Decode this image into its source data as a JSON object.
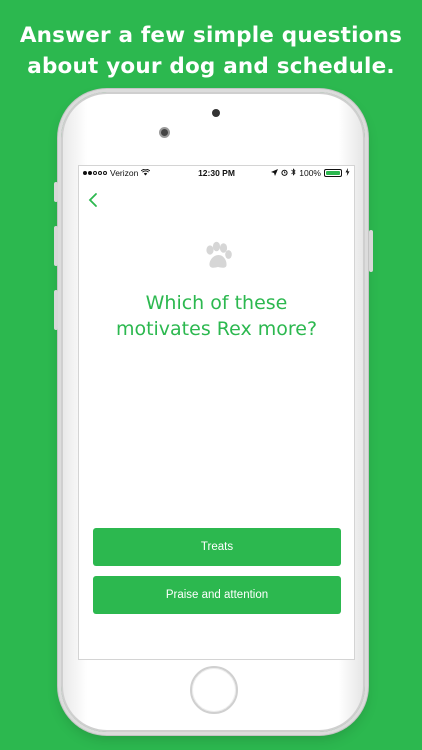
{
  "headline": {
    "line1": "Answer a few simple questions",
    "line2": "about your dog and schedule."
  },
  "status_bar": {
    "carrier": "Verizon",
    "time": "12:30 PM",
    "battery": "100%"
  },
  "screen": {
    "question_line1": "Which of these",
    "question_line2": "motivates Rex more?",
    "answers": [
      {
        "label": "Treats"
      },
      {
        "label": "Praise and attention"
      }
    ]
  },
  "colors": {
    "brand_green": "#2cb84f",
    "screen_bg": "#ffffff",
    "paw_gray": "#d6d6d6"
  },
  "icons": {
    "back": "chevron-left-icon",
    "paw": "paw-icon",
    "wifi": "wifi-icon",
    "location": "location-arrow-icon",
    "alarm": "alarm-icon",
    "bluetooth": "bluetooth-icon",
    "battery": "battery-icon",
    "charging": "charging-bolt-icon"
  }
}
